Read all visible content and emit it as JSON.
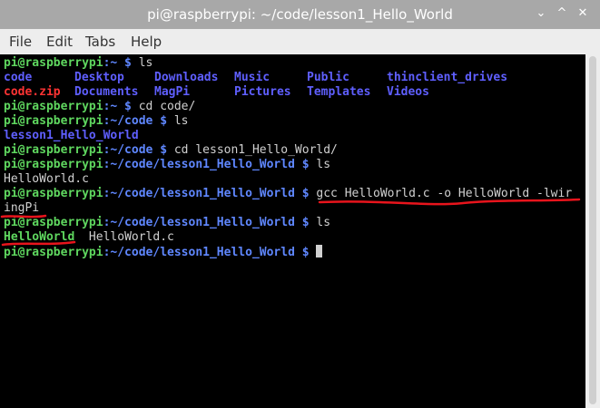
{
  "window": {
    "title": "pi@raspberrypi: ~/code/lesson1_Hello_World",
    "minimize_glyph": "⌄",
    "maximize_glyph": "^",
    "close_glyph": "✕"
  },
  "menu": {
    "file": "File",
    "edit": "Edit",
    "tabs": "Tabs",
    "help": "Help"
  },
  "terminal": {
    "user_host": "pi@raspberrypi",
    "line1": {
      "path": ":~ $",
      "cmd": " ls"
    },
    "ls_home": {
      "row1": [
        "code",
        "Desktop",
        "Downloads",
        "Music",
        "Public",
        "thinclient_drives"
      ],
      "row2": [
        "code.zip",
        "Documents",
        "MagPi",
        "Pictures",
        "Templates",
        "Videos"
      ]
    },
    "line4": {
      "path": ":~ $",
      "cmd": " cd code/"
    },
    "line5": {
      "path": ":~/code $",
      "cmd": " ls"
    },
    "line6": "lesson1_Hello_World",
    "line7": {
      "path": ":~/code $",
      "cmd": " cd lesson1_Hello_World/"
    },
    "line8": {
      "path": ":~/code/lesson1_Hello_World $",
      "cmd": " ls"
    },
    "line9": "HelloWorld.c",
    "line10": {
      "path": ":~/code/lesson1_Hello_World $",
      "cmd": " gcc HelloWorld.c -o HelloWorld -lwir"
    },
    "line11": "ingPi",
    "line12": {
      "path": ":~/code/lesson1_Hello_World $",
      "cmd": " ls"
    },
    "line13": {
      "exe": "HelloWorld",
      "file": "  HelloWorld.c"
    },
    "line14": {
      "path": ":~/code/lesson1_Hello_World $",
      "cmd": " "
    }
  },
  "annotation_color": "#e8141c"
}
